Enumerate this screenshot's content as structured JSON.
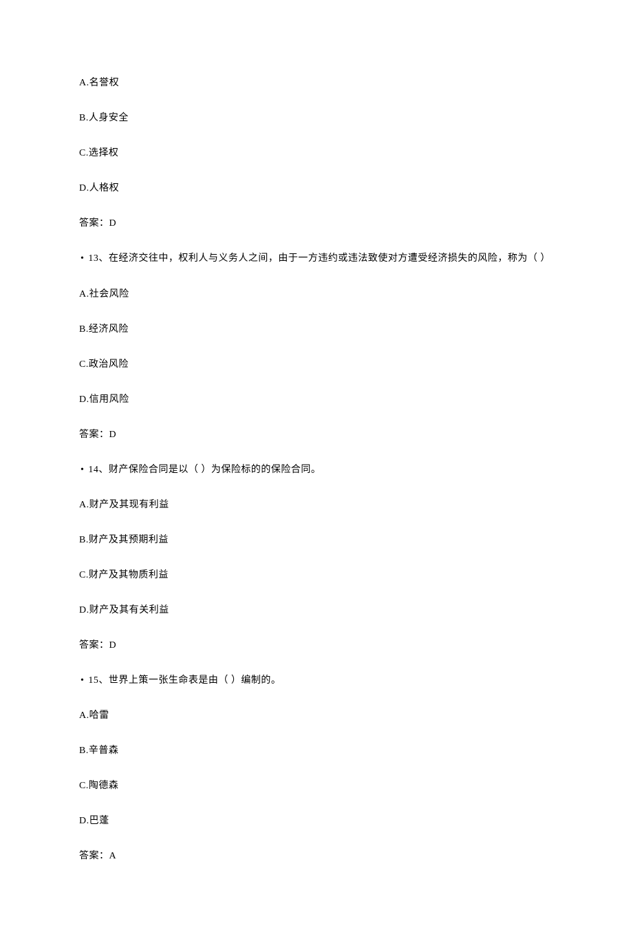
{
  "q12": {
    "optA": "A.名誉权",
    "optB": "B.人身安全",
    "optC": "C.选择权",
    "optD": "D.人格权",
    "answer": "答案：D"
  },
  "q13": {
    "text": "13、在经济交往中，权利人与义务人之间，由于一方违约或违法致使对方遭受经济损失的风险，称为（ ）",
    "optA": "A.社会风险",
    "optB": "B.经济风险",
    "optC": "C.政治风险",
    "optD": "D.信用风险",
    "answer": "答案：D"
  },
  "q14": {
    "text": "14、财产保险合同是以（ ）为保险标的的保险合同。",
    "optA": "A.财产及其现有利益",
    "optB": "B.财产及其预期利益",
    "optC": "C.财产及其物质利益",
    "optD": "D.财产及其有关利益",
    "answer": "答案：D"
  },
  "q15": {
    "text": "15、世界上策一张生命表是由（ ）编制的。",
    "optA": "A.哈雷",
    "optB": "B.辛普森",
    "optC": "C.陶德森",
    "optD": "D.巴蓬",
    "answer": "答案：A"
  }
}
